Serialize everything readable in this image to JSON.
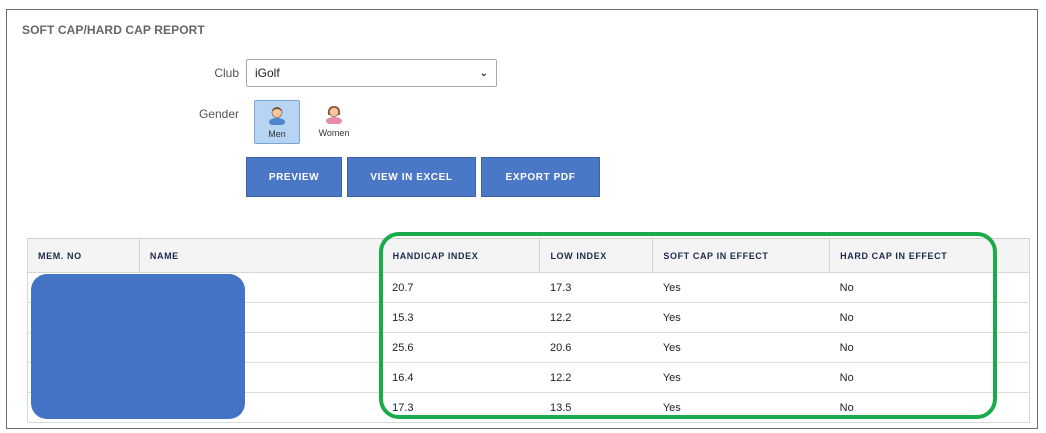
{
  "report": {
    "title": "SOFT CAP/HARD CAP REPORT"
  },
  "filters": {
    "club_label": "Club",
    "club_value": "iGolf",
    "gender_label": "Gender",
    "gender_options": [
      {
        "label": "Men",
        "selected": true
      },
      {
        "label": "Women",
        "selected": false
      }
    ]
  },
  "actions": {
    "preview_label": "PREVIEW",
    "excel_label": "VIEW IN EXCEL",
    "pdf_label": "EXPORT PDF"
  },
  "table": {
    "columns": [
      "MEM. NO",
      "NAME",
      "HANDICAP INDEX",
      "LOW INDEX",
      "SOFT CAP IN EFFECT",
      "HARD CAP IN EFFECT"
    ],
    "rows": [
      {
        "mem_no": "",
        "name": "",
        "handicap_index": "20.7",
        "low_index": "17.3",
        "soft_cap": "Yes",
        "hard_cap": "No"
      },
      {
        "mem_no": "",
        "name": "",
        "handicap_index": "15.3",
        "low_index": "12.2",
        "soft_cap": "Yes",
        "hard_cap": "No"
      },
      {
        "mem_no": "",
        "name": "",
        "handicap_index": "25.6",
        "low_index": "20.6",
        "soft_cap": "Yes",
        "hard_cap": "No"
      },
      {
        "mem_no": "",
        "name": "",
        "handicap_index": "16.4",
        "low_index": "12.2",
        "soft_cap": "Yes",
        "hard_cap": "No"
      },
      {
        "mem_no": "",
        "name": "",
        "handicap_index": "17.3",
        "low_index": "13.5",
        "soft_cap": "Yes",
        "hard_cap": "No"
      }
    ]
  },
  "colors": {
    "button_blue": "#4a77c6",
    "selected_gender_bg": "#b7d5f3",
    "redaction_blue": "#4472c4",
    "highlight_green": "#1aab4b"
  },
  "icons": [
    "man-avatar-icon",
    "woman-avatar-icon",
    "chevron-down-icon"
  ]
}
